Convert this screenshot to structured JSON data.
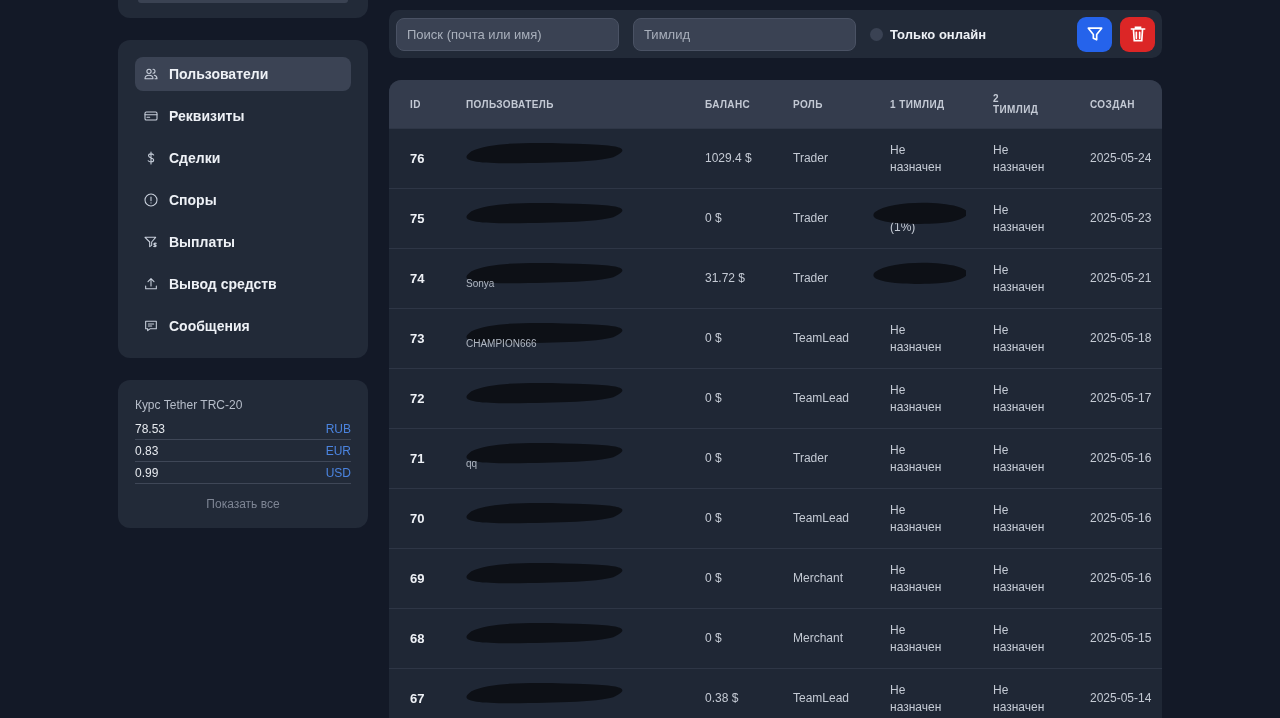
{
  "sidebar": {
    "nav": [
      {
        "label": "Пользователи",
        "selected": true
      },
      {
        "label": "Реквизиты",
        "selected": false
      },
      {
        "label": "Сделки",
        "selected": false
      },
      {
        "label": "Споры",
        "selected": false
      },
      {
        "label": "Выплаты",
        "selected": false
      },
      {
        "label": "Вывод средств",
        "selected": false
      },
      {
        "label": "Сообщения",
        "selected": false
      }
    ],
    "rates": {
      "title": "Курс Tether TRC-20",
      "items": [
        {
          "value": "78.53",
          "currency": "RUB"
        },
        {
          "value": "0.83",
          "currency": "EUR"
        },
        {
          "value": "0.99",
          "currency": "USD"
        }
      ],
      "show_all": "Показать все"
    }
  },
  "filters": {
    "search": {
      "placeholder": "Поиск (почта или имя)"
    },
    "teamlead": {
      "placeholder": "Тимлид"
    },
    "online_only": {
      "label": "Только онлайн",
      "checked": false
    }
  },
  "table": {
    "columns": [
      "ID",
      "ПОЛЬЗОВАТЕЛЬ",
      "БАЛАНС",
      "РОЛЬ",
      "1 ТИМЛИД",
      "2 ТИМЛИД",
      "СОЗДАН"
    ],
    "rows": [
      {
        "id": "76",
        "balance": "1029.4 $",
        "role": "Trader",
        "lead1": {
          "text": "Не назначен",
          "redacted": false
        },
        "lead2": "Не назначен",
        "created": "2025-05-24"
      },
      {
        "id": "75",
        "balance": "0 $",
        "role": "Trader",
        "lead1": {
          "text": "(1%)",
          "redacted": true
        },
        "lead2": "Не назначен",
        "created": "2025-05-23"
      },
      {
        "id": "74",
        "name": "Sonya",
        "balance": "31.72 $",
        "role": "Trader",
        "lead1": {
          "redacted": true
        },
        "lead2": "Не назначен",
        "created": "2025-05-21"
      },
      {
        "id": "73",
        "name": "CHAMPION666",
        "balance": "0 $",
        "role": "TeamLead",
        "lead1": {
          "text": "Не назначен",
          "redacted": false
        },
        "lead2": "Не назначен",
        "created": "2025-05-18"
      },
      {
        "id": "72",
        "balance": "0 $",
        "role": "TeamLead",
        "lead1": {
          "text": "Не назначен",
          "redacted": false
        },
        "lead2": "Не назначен",
        "created": "2025-05-17"
      },
      {
        "id": "71",
        "name": "qq",
        "balance": "0 $",
        "role": "Trader",
        "lead1": {
          "text": "Не назначен",
          "redacted": false
        },
        "lead2": "Не назначен",
        "created": "2025-05-16"
      },
      {
        "id": "70",
        "balance": "0 $",
        "role": "TeamLead",
        "lead1": {
          "text": "Не назначен",
          "redacted": false
        },
        "lead2": "Не назначен",
        "created": "2025-05-16"
      },
      {
        "id": "69",
        "balance": "0 $",
        "role": "Merchant",
        "lead1": {
          "text": "Не назначен",
          "redacted": false
        },
        "lead2": "Не назначен",
        "created": "2025-05-16"
      },
      {
        "id": "68",
        "balance": "0 $",
        "role": "Merchant",
        "lead1": {
          "text": "Не назначен",
          "redacted": false
        },
        "lead2": "Не назначен",
        "created": "2025-05-15"
      },
      {
        "id": "67",
        "balance": "0.38 $",
        "role": "TeamLead",
        "lead1": {
          "text": "Не назначен",
          "redacted": false
        },
        "lead2": "Не назначен",
        "created": "2025-05-14"
      }
    ]
  }
}
